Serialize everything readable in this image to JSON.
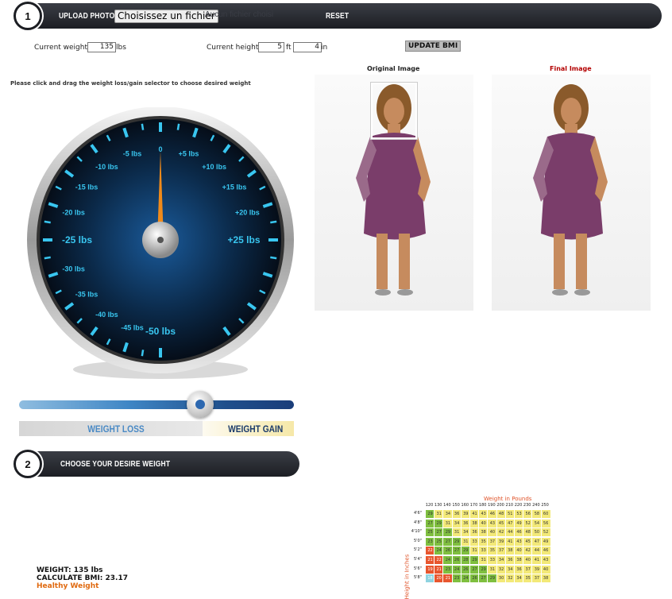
{
  "toolbar": {
    "step_number": "1",
    "upload_label": "UPLOAD PHOTO",
    "file_button_label": "Choisissez un fichier",
    "file_status": "Aucun fichier choisi",
    "reset_label": "RESET"
  },
  "measurements": {
    "weight_label": "Current weight:",
    "weight_value": "135",
    "weight_unit": "lbs",
    "height_label": "Current height:",
    "height_feet": "5",
    "feet_unit": "ft",
    "height_inches": "4",
    "inch_unit": "in",
    "update_button": "UPDATE BMI"
  },
  "instruction": "Please click and drag the weight loss/gain selector to choose desired weight",
  "images": {
    "original_title": "Original Image",
    "final_title": "Final Image",
    "final_title_color": "#b30000"
  },
  "gauge": {
    "needle_value_lbs": 0,
    "labels": [
      "0",
      "-5 lbs",
      "+5 lbs",
      "-10 lbs",
      "+10 lbs",
      "-15 lbs",
      "+15 lbs",
      "-20 lbs",
      "+20 lbs",
      "-25 lbs",
      "+25 lbs",
      "-30 lbs",
      "-35 lbs",
      "-40 lbs",
      "-45 lbs",
      "-50 lbs"
    ]
  },
  "slider": {
    "position_fraction": 0.66,
    "loss_label": "WEIGHT LOSS",
    "gain_label": "WEIGHT GAIN"
  },
  "step2": {
    "step_number": "2",
    "label": "CHOOSE YOUR DESIRE WEIGHT"
  },
  "result": {
    "weight_text": "WEIGHT: 135 lbs",
    "bmi_text": "CALCULATE BMI: 23.17",
    "category_text": "Healthy Weight",
    "category_color": "#e06a10"
  },
  "bmi_chart": {
    "title": "Weight in Pounds",
    "ylabel": "Height in Inches",
    "weights": [
      "120",
      "130",
      "140",
      "150",
      "160",
      "170",
      "180",
      "190",
      "200",
      "210",
      "220",
      "230",
      "240",
      "250"
    ],
    "rows": [
      {
        "height": "4'6\"",
        "values": [
          "29",
          "31",
          "34",
          "36",
          "39",
          "41",
          "43",
          "46",
          "48",
          "51",
          "53",
          "56",
          "58",
          "60"
        ]
      },
      {
        "height": "4'8\"",
        "values": [
          "27",
          "29",
          "31",
          "34",
          "36",
          "38",
          "40",
          "43",
          "45",
          "47",
          "49",
          "52",
          "54",
          "56"
        ]
      },
      {
        "height": "4'10\"",
        "values": [
          "25",
          "27",
          "29",
          "31",
          "34",
          "36",
          "38",
          "40",
          "42",
          "44",
          "46",
          "48",
          "50",
          "52"
        ]
      },
      {
        "height": "5'0\"",
        "values": [
          "23",
          "25",
          "27",
          "29",
          "31",
          "33",
          "35",
          "37",
          "39",
          "41",
          "43",
          "45",
          "47",
          "49"
        ]
      },
      {
        "height": "5'2\"",
        "values": [
          "22",
          "24",
          "26",
          "27",
          "29",
          "31",
          "33",
          "35",
          "37",
          "38",
          "40",
          "42",
          "44",
          "46"
        ]
      },
      {
        "height": "5'4\"",
        "values": [
          "21",
          "22",
          "24",
          "26",
          "28",
          "29",
          "31",
          "33",
          "34",
          "36",
          "38",
          "40",
          "41",
          "43"
        ]
      },
      {
        "height": "5'6\"",
        "values": [
          "19",
          "21",
          "23",
          "24",
          "26",
          "27",
          "29",
          "31",
          "32",
          "34",
          "36",
          "37",
          "39",
          "40"
        ]
      },
      {
        "height": "5'8\"",
        "values": [
          "18",
          "20",
          "21",
          "23",
          "24",
          "26",
          "27",
          "29",
          "30",
          "32",
          "34",
          "35",
          "37",
          "38"
        ]
      }
    ],
    "colors": {
      "underweight": "#8fd3e0",
      "healthy": "#7fbf3f",
      "overweight": "#f3e978",
      "obese": "#f1e28a",
      "red": "#e8562e"
    }
  }
}
